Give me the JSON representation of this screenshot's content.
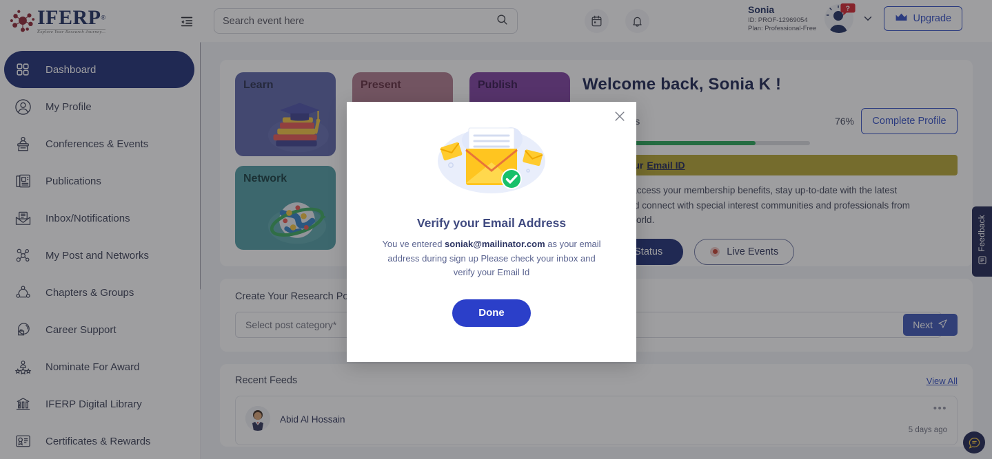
{
  "header": {
    "logo_word": "IFERP",
    "logo_reg": "®",
    "logo_tagline": "Explore Your Research Journey...",
    "collapse_icon": "collapse-sidebar-icon",
    "search": {
      "placeholder": "Search event here",
      "value": "",
      "icon": "search-icon"
    },
    "calendar_icon": "calendar-icon",
    "bell_icon": "bell-icon",
    "user": {
      "name": "Sonia",
      "id": "ID: PROF-12969054",
      "plan": "Plan: Professional-Free",
      "avatar": "avatar",
      "badge_icon": "question-badge-icon",
      "chevron_icon": "chevron-down-icon"
    },
    "upgrade": {
      "label": "Upgrade",
      "icon": "crown-icon"
    }
  },
  "sidebar": {
    "items": [
      {
        "label": "Dashboard",
        "icon": "grid-icon",
        "active": true
      },
      {
        "label": "My Profile",
        "icon": "user-circle-icon",
        "active": false
      },
      {
        "label": "Conferences & Events",
        "icon": "podium-icon",
        "active": false
      },
      {
        "label": "Publications",
        "icon": "newspaper-icon",
        "active": false
      },
      {
        "label": "Inbox/Notifications",
        "icon": "envelope-icon",
        "active": false
      },
      {
        "label": "My Post and Networks",
        "icon": "network-icon",
        "active": false
      },
      {
        "label": "Chapters & Groups",
        "icon": "group-icon",
        "active": false
      },
      {
        "label": "Career Support",
        "icon": "briefcase-icon",
        "active": false
      },
      {
        "label": "Nominate For Award",
        "icon": "award-icon",
        "active": false
      },
      {
        "label": "IFERP Digital Library",
        "icon": "library-icon",
        "active": false
      },
      {
        "label": "Certificates & Rewards",
        "icon": "certificate-icon",
        "active": false
      }
    ]
  },
  "main": {
    "tiles": [
      {
        "label": "Learn",
        "color": "#5a63a8"
      },
      {
        "label": "Present",
        "color": "#b0788c"
      },
      {
        "label": "Publish",
        "color": "#7c3d9e"
      },
      {
        "label": "Network",
        "color": "#4e9ca2"
      }
    ],
    "welcome": "Welcome back, Sonia K !",
    "profile_status_label": "Profile Status",
    "profile_status_pct": "76%",
    "profile_progress_value": 76,
    "complete_profile_label": "Complete Profile",
    "alert": {
      "prefix": "Verify your",
      "link": "Email ID",
      "body": "So you can access your membership benefits, stay up-to-date with the latest research, and connect with special interest communities and professionals from around the world."
    },
    "check_status_label": "Check Status",
    "live_events_label": "Live Events",
    "create_post": {
      "title": "Create Your Research Post",
      "category_placeholder": "Select post category*",
      "text_value": "",
      "next_label": "Next",
      "next_icon": "send-icon"
    },
    "recent_feeds": {
      "title": "Recent Feeds",
      "view_all": "View All",
      "items": [
        {
          "name": "Abid Al Hossain",
          "time": "5 days ago",
          "menu_icon": "more-dots-icon"
        }
      ]
    }
  },
  "rail": {
    "feedback_label": "Feedback",
    "feedback_icon": "feedback-note-icon",
    "chat_icon": "chat-bubble-icon"
  },
  "modal": {
    "close_icon": "close-icon",
    "illustration": "email-verify-illustration",
    "title": "Verify your Email Address",
    "desc_before": "You ve entered ",
    "desc_email": "soniak@mailinator.com",
    "desc_after": " as your email address during sign up Please check your inbox and verify your Email Id",
    "done_label": "Done"
  },
  "colors": {
    "brand_navy": "#1b2a73",
    "accent_blue": "#2b3fc9",
    "progress_green": "#23a455",
    "alert_yellow": "#b5a52f",
    "page_bg": "#f3f4f8"
  }
}
